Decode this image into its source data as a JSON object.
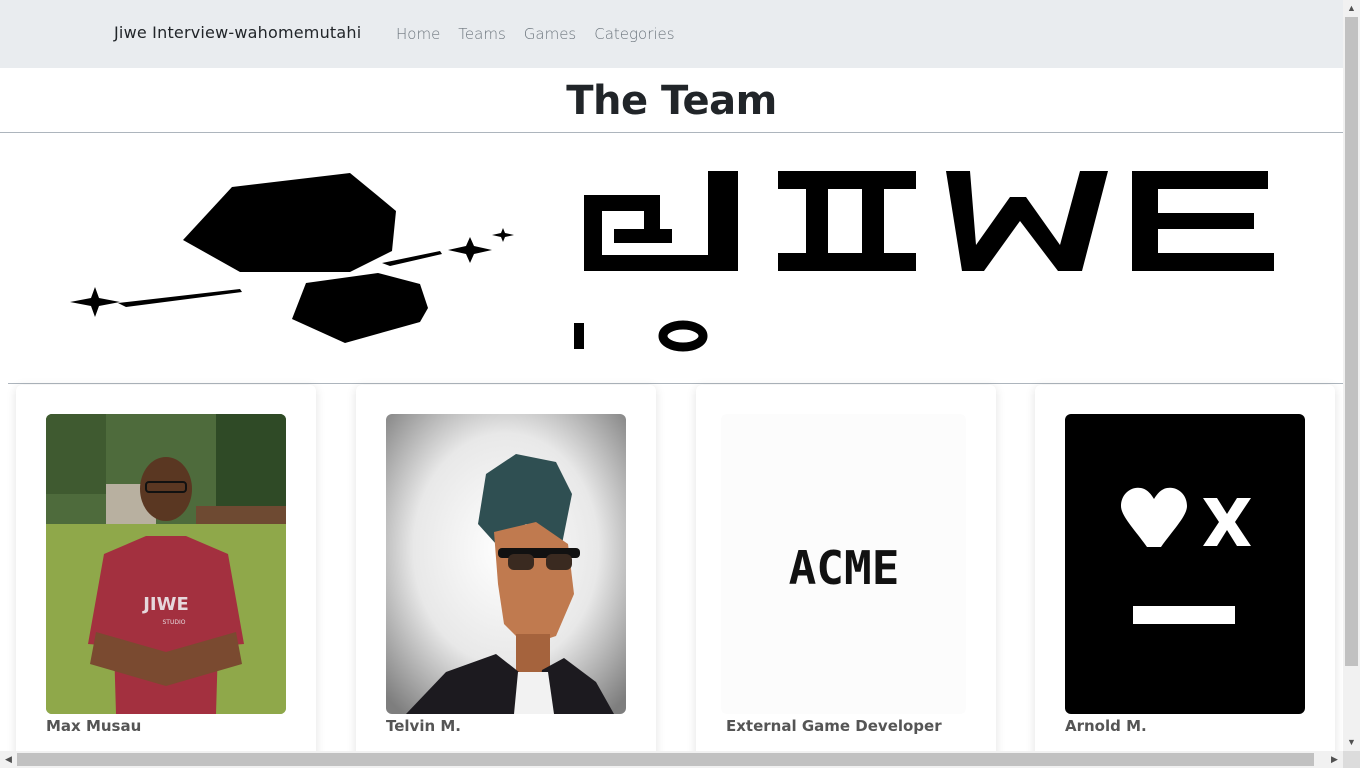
{
  "navbar": {
    "brand": "Jiwe Interview-wahomemutahi",
    "links": [
      "Home",
      "Teams",
      "Games",
      "Categories"
    ]
  },
  "page_title": "The Team",
  "banner": {
    "logo_text": "JIWE"
  },
  "team": [
    {
      "name": "Max Musau",
      "shirt_logo": "JIWE",
      "shirt_sub": "STUDIO"
    },
    {
      "name": "Telvin M."
    },
    {
      "name": "External Game Developer",
      "logo_text": "ACME"
    },
    {
      "name": "Arnold M."
    }
  ],
  "colors": {
    "navbar_bg": "#e9ecef",
    "shirt": "#a3303f",
    "grass": "#8fa84a"
  }
}
